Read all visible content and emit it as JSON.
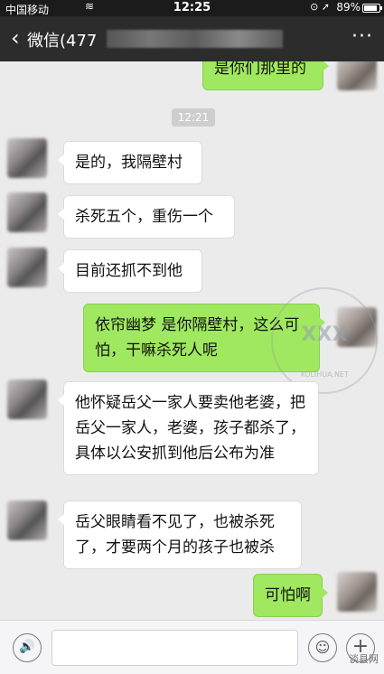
{
  "status_bar": {
    "carrier": "中国移动",
    "time": "12:25",
    "battery_percent": "89%",
    "icons": [
      "wifi-icon",
      "location-icon",
      "alarm-icon",
      "battery-icon"
    ]
  },
  "nav": {
    "back_label": "微信(477",
    "title": "",
    "more_label": "···"
  },
  "chat": {
    "timestamp": "12:21",
    "messages": [
      {
        "from": "me",
        "text": "是你们那里的"
      },
      {
        "from": "other",
        "text": "是的，我隔壁村"
      },
      {
        "from": "other",
        "text": "杀死五个，重伤一个"
      },
      {
        "from": "other",
        "text": "目前还抓不到他"
      },
      {
        "from": "me",
        "text": "依帘幽梦 是你隔壁村，这么可怕，干嘛杀死人呢"
      },
      {
        "from": "other",
        "text": "他怀疑岳父一家人要卖他老婆，把岳父一家人，老婆，孩子都杀了，具体以公安抓到他后公布为准"
      },
      {
        "from": "other",
        "text": "岳父眼睛看不见了，也被杀死了，才要两个月的孩子也被杀"
      },
      {
        "from": "me",
        "text": "可怕啊"
      }
    ]
  },
  "watermark": {
    "text": "XXX",
    "url": "XOLIHUA.NET"
  },
  "input_bar": {
    "voice_icon": "🔊",
    "emoji_icon": "☺",
    "plus_icon": "+",
    "source_text": "谈县网"
  },
  "colors": {
    "nav_bg": "#2c2c2c",
    "chat_bg": "#ebebeb",
    "outgoing_bubble": "#9fe85f",
    "incoming_bubble": "#ffffff"
  }
}
